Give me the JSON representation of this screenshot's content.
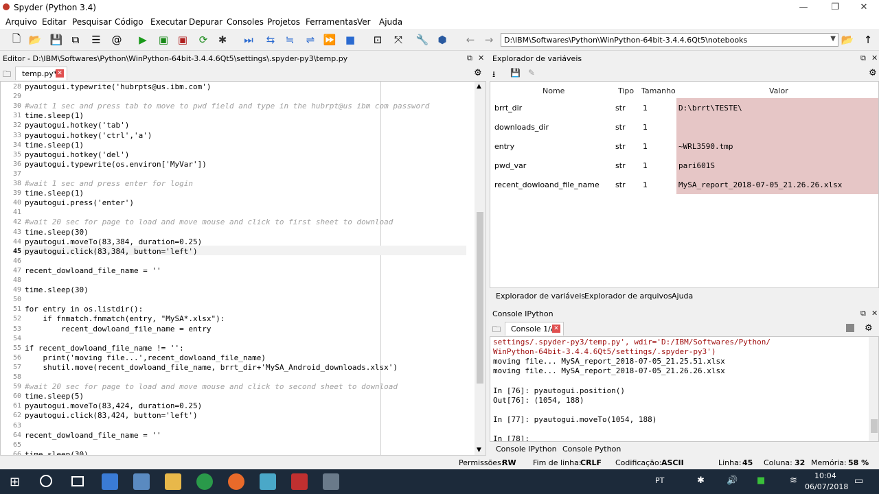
{
  "window": {
    "title": "Spyder (Python 3.4)"
  },
  "menu": [
    "Arquivo",
    "Editar",
    "Pesquisar",
    "Código",
    "Executar",
    "Depurar",
    "Consoles",
    "Projetos",
    "Ferramentas",
    "Ver",
    "Ajuda"
  ],
  "path": "D:\\IBM\\Softwares\\Python\\WinPython-64bit-3.4.4.6Qt5\\notebooks",
  "editor": {
    "header": "Editor - D:\\IBM\\Softwares\\Python\\WinPython-64bit-3.4.4.6Qt5\\settings\\.spyder-py3\\temp.py",
    "tab": "temp.py*",
    "lines": [
      {
        "n": "28",
        "t": "pyautogui.typewrite('hubrpts@us.ibm.com')",
        "c": ""
      },
      {
        "n": "29",
        "t": "",
        "c": ""
      },
      {
        "n": "30",
        "t": "#wait 1 sec and press tab to move to pwd field and type in the hubrpt@us ibm com password",
        "c": "cm"
      },
      {
        "n": "31",
        "t": "time.sleep(1)",
        "c": ""
      },
      {
        "n": "32",
        "t": "pyautogui.hotkey('tab')",
        "c": ""
      },
      {
        "n": "33",
        "t": "pyautogui.hotkey('ctrl','a')",
        "c": ""
      },
      {
        "n": "34",
        "t": "time.sleep(1)",
        "c": ""
      },
      {
        "n": "35",
        "t": "pyautogui.hotkey('del')",
        "c": ""
      },
      {
        "n": "36",
        "t": "pyautogui.typewrite(os.environ['MyVar'])",
        "c": ""
      },
      {
        "n": "37",
        "t": "",
        "c": ""
      },
      {
        "n": "38",
        "t": "#wait 1 sec and press enter for login",
        "c": "cm"
      },
      {
        "n": "39",
        "t": "time.sleep(1)",
        "c": ""
      },
      {
        "n": "40",
        "t": "pyautogui.press('enter')",
        "c": ""
      },
      {
        "n": "41",
        "t": "",
        "c": ""
      },
      {
        "n": "42",
        "t": "#wait 20 sec for page to load and move mouse and click to first sheet to download",
        "c": "cm"
      },
      {
        "n": "43",
        "t": "time.sleep(30)",
        "c": ""
      },
      {
        "n": "44",
        "t": "pyautogui.moveTo(83,384, duration=0.25)",
        "c": ""
      },
      {
        "n": "45",
        "t": "pyautogui.click(83,384, button='left')",
        "c": ""
      },
      {
        "n": "46",
        "t": "",
        "c": ""
      },
      {
        "n": "47",
        "t": "recent_dowloand_file_name = ''",
        "c": ""
      },
      {
        "n": "48",
        "t": "",
        "c": ""
      },
      {
        "n": "49",
        "t": "time.sleep(30)",
        "c": ""
      },
      {
        "n": "50",
        "t": "",
        "c": ""
      },
      {
        "n": "51",
        "t": "for entry in os.listdir():",
        "c": ""
      },
      {
        "n": "52",
        "t": "    if fnmatch.fnmatch(entry, \"MySA*.xlsx\"):",
        "c": ""
      },
      {
        "n": "53",
        "t": "        recent_dowloand_file_name = entry",
        "c": ""
      },
      {
        "n": "54",
        "t": "",
        "c": ""
      },
      {
        "n": "55",
        "t": "if recent_dowloand_file_name != '':",
        "c": ""
      },
      {
        "n": "56",
        "t": "    print('moving file...',recent_dowloand_file_name)",
        "c": ""
      },
      {
        "n": "57",
        "t": "    shutil.move(recent_dowloand_file_name, brrt_dir+'MySA_Android_downloads.xlsx')",
        "c": ""
      },
      {
        "n": "58",
        "t": "",
        "c": ""
      },
      {
        "n": "59",
        "t": "#wait 20 sec for page to load and move mouse and click to second sheet to download",
        "c": "cm"
      },
      {
        "n": "60",
        "t": "time.sleep(5)",
        "c": ""
      },
      {
        "n": "61",
        "t": "pyautogui.moveTo(83,424, duration=0.25)",
        "c": ""
      },
      {
        "n": "62",
        "t": "pyautogui.click(83,424, button='left')",
        "c": ""
      },
      {
        "n": "63",
        "t": "",
        "c": ""
      },
      {
        "n": "64",
        "t": "recent_dowloand_file_name = ''",
        "c": ""
      },
      {
        "n": "65",
        "t": "",
        "c": ""
      },
      {
        "n": "66",
        "t": "time.sleep(30)",
        "c": ""
      }
    ]
  },
  "varexplorer": {
    "header": "Explorador de variáveis",
    "columns": [
      "Nome",
      "Tipo",
      "Tamanho",
      "Valor"
    ],
    "rows": [
      {
        "name": "brrt_dir",
        "type": "str",
        "size": "1",
        "value": "D:\\brrt\\TESTE\\"
      },
      {
        "name": "downloads_dir",
        "type": "str",
        "size": "1",
        "value": ""
      },
      {
        "name": "entry",
        "type": "str",
        "size": "1",
        "value": "~WRL3590.tmp"
      },
      {
        "name": "pwd_var",
        "type": "str",
        "size": "1",
        "value": "pari601S"
      },
      {
        "name": "recent_dowloand_file_name",
        "type": "str",
        "size": "1",
        "value": "MySA_report_2018-07-05_21.26.26.xlsx"
      }
    ],
    "tabs": [
      "Explorador de variáveis",
      "Explorador de arquivos",
      "Ajuda"
    ]
  },
  "console": {
    "header": "Console IPython",
    "tab": "Console 1/A",
    "lines": [
      {
        "t": "settings/.spyder-py3/temp.py', wdir='D:/IBM/Softwares/Python/",
        "c": "red"
      },
      {
        "t": "WinPython-64bit-3.4.4.6Qt5/settings/.spyder-py3')",
        "c": "red"
      },
      {
        "t": "moving file... MySA_report_2018-07-05_21.25.51.xlsx",
        "c": ""
      },
      {
        "t": "moving file... MySA_report_2018-07-05_21.26.26.xlsx",
        "c": ""
      },
      {
        "t": "",
        "c": ""
      },
      {
        "t": "In [76]: pyautogui.position()",
        "c": ""
      },
      {
        "t": "Out[76]: (1054, 188)",
        "c": ""
      },
      {
        "t": "",
        "c": ""
      },
      {
        "t": "In [77]: pyautogui.moveTo(1054, 188)",
        "c": ""
      },
      {
        "t": "",
        "c": ""
      },
      {
        "t": "In [78]:",
        "c": ""
      }
    ],
    "tabs": [
      "Console IPython",
      "Console Python"
    ]
  },
  "status": {
    "perm_label": "Permissões:",
    "perm": "RW",
    "eol_label": "Fim de linha:",
    "eol": "CRLF",
    "enc_label": "Codificação:",
    "enc": "ASCII",
    "line_label": "Linha:",
    "line": "45",
    "col_label": "Coluna:",
    "col": "32",
    "mem_label": "Memória:",
    "mem": "58 %"
  },
  "taskbar": {
    "lang": "PT",
    "time": "10:04",
    "date": "06/07/2018"
  }
}
